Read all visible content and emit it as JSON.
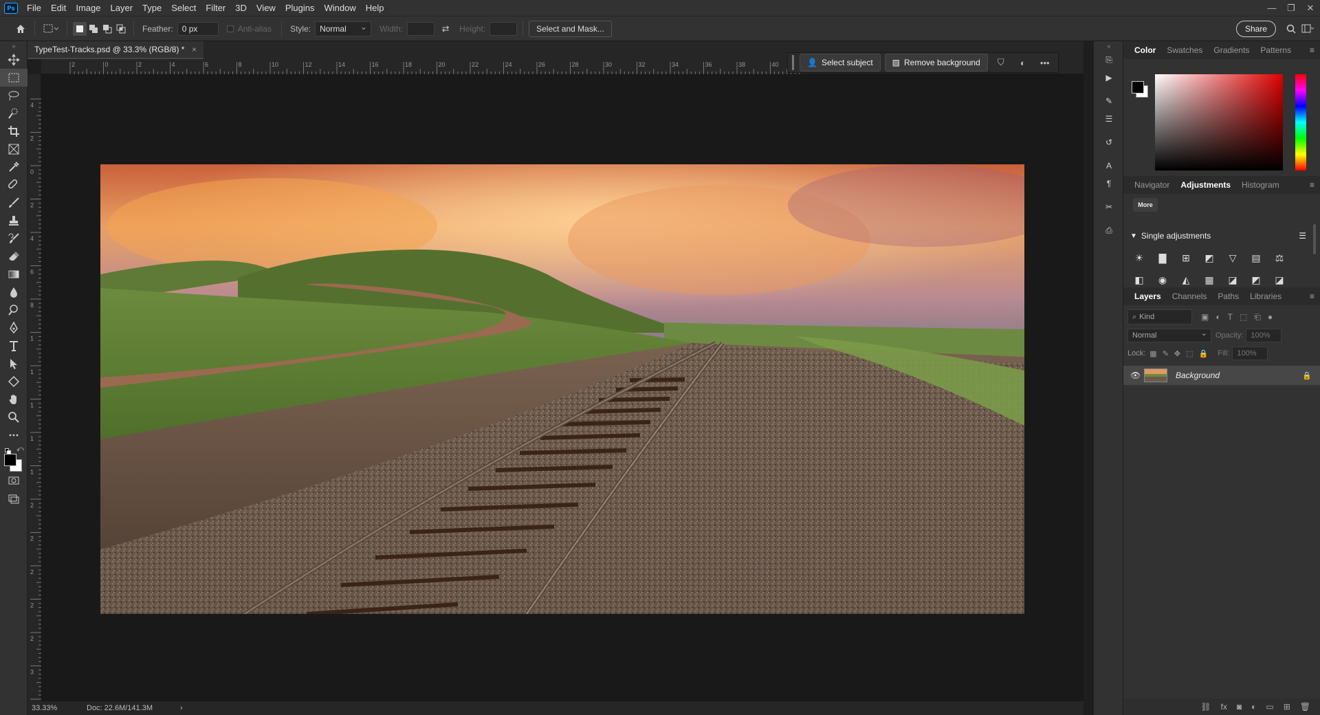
{
  "app": {
    "logo": "Ps"
  },
  "menu": [
    "File",
    "Edit",
    "Image",
    "Layer",
    "Type",
    "Select",
    "Filter",
    "3D",
    "View",
    "Plugins",
    "Window",
    "Help"
  ],
  "window_controls": [
    "—",
    "❐",
    "✕"
  ],
  "options": {
    "feather_label": "Feather:",
    "feather_value": "0 px",
    "antialias_label": "Anti-alias",
    "style_label": "Style:",
    "style_value": "Normal",
    "width_label": "Width:",
    "height_label": "Height:",
    "select_mask": "Select and Mask...",
    "share": "Share"
  },
  "document": {
    "tab_title": "TypeTest-Tracks.psd @ 33.3% (RGB/8) *",
    "close": "×"
  },
  "ruler_h_labels": [
    "2",
    "0",
    "2",
    "4",
    "6",
    "8",
    "10",
    "12",
    "14",
    "16",
    "18",
    "20",
    "22",
    "24",
    "26",
    "28",
    "30",
    "32",
    "34",
    "36",
    "38",
    "40"
  ],
  "ruler_v_labels": [
    "4",
    "2",
    "0",
    "2",
    "4",
    "6",
    "8",
    "1",
    "1",
    "1",
    "1",
    "1",
    "2",
    "2",
    "2",
    "2",
    "2",
    "3",
    "3"
  ],
  "context_bar": {
    "select_subject": "Select subject",
    "remove_background": "Remove background",
    "more": "•••"
  },
  "status": {
    "zoom": "33.33%",
    "doc": "Doc: 22.6M/141.3M",
    "arrow": "›"
  },
  "color_panel": {
    "tabs": [
      "Color",
      "Swatches",
      "Gradients",
      "Patterns"
    ],
    "hue_color": "#ff0000"
  },
  "adjust_panel": {
    "tabs": [
      "Navigator",
      "Adjustments",
      "Histogram"
    ],
    "more": "More",
    "single_adjustments": "Single adjustments",
    "icons_row1": [
      "☀",
      "▇",
      "⊞",
      "◩",
      "▽",
      "▤",
      "⚖"
    ],
    "icons_row2": [
      "◧",
      "◉",
      "◭",
      "▦",
      "◪",
      "◩",
      "◪"
    ]
  },
  "layers_panel": {
    "tabs": [
      "Layers",
      "Channels",
      "Paths",
      "Libraries"
    ],
    "kind": "Kind",
    "blend_mode": "Normal",
    "opacity_label": "Opacity:",
    "opacity_value": "100%",
    "lock_label": "Lock:",
    "fill_label": "Fill:",
    "fill_value": "100%",
    "layer_name": "Background"
  }
}
